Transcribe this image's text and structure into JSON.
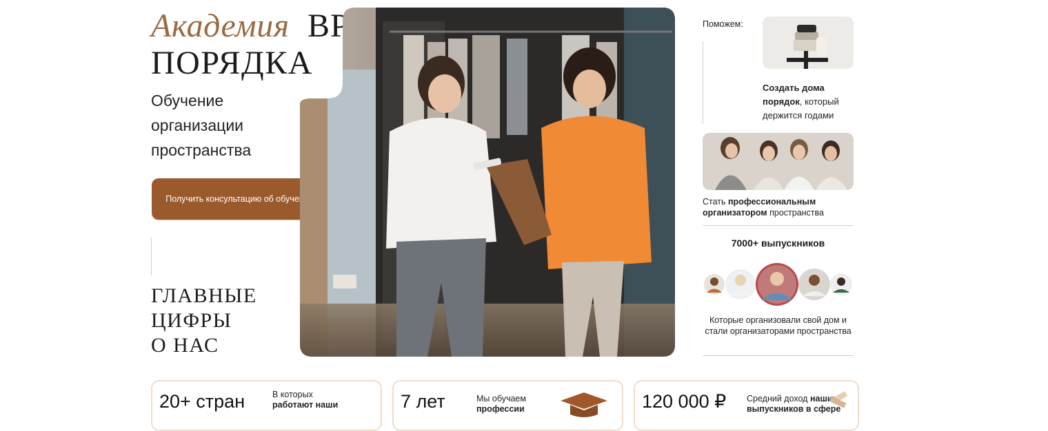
{
  "hero": {
    "title_academy": "Академия",
    "title_time": "ВРЕМЯ",
    "title_order": "ПОРЯДКА",
    "subtitle_lines": [
      "Обучение",
      "организации",
      "пространства"
    ],
    "cta_label": "Получить консультацию об обучении",
    "numbers_title_lines": [
      "ГЛАВНЫЕ",
      "ЦИФРЫ",
      "О НАС"
    ]
  },
  "aside": {
    "help_label": "Поможем:",
    "help_text": {
      "bold": "Создать дома порядок",
      "rest": ", который держится годами"
    },
    "pro_text": {
      "prefix": "Стать ",
      "bold": "профессиональным организатором",
      "suffix": " пространства"
    },
    "graduates_title": "7000+ выпускников",
    "graduates_text": "Которые организовали свой дом и стали организаторами пространства"
  },
  "stats": [
    {
      "big": "20+ стран",
      "small_plain": "В которых",
      "small_bold": "работают наши"
    },
    {
      "big": "7 лет",
      "small_plain": "Мы обучаем",
      "small_bold": "профессии"
    },
    {
      "big": "120 000 ₽",
      "small_plain": "Средний доход ",
      "small_bold": "наших выпускников в сфере"
    }
  ],
  "colors": {
    "accent_brown": "#9b5a2c",
    "academy_brown": "#9a6a43",
    "card_border": "#f0dccb",
    "orange_sweater": "#f08a34"
  },
  "icons": [
    "graduation-cap-icon",
    "measuring-tape-icon"
  ]
}
